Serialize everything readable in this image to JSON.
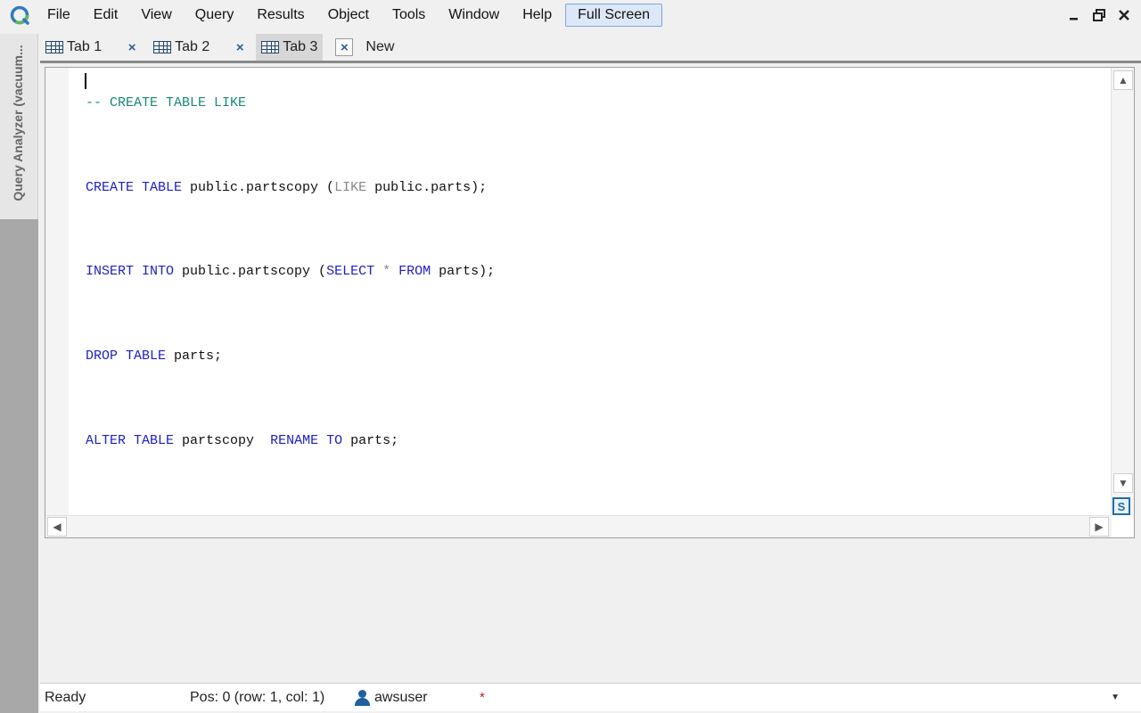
{
  "menu": {
    "items": [
      "File",
      "Edit",
      "View",
      "Query",
      "Results",
      "Object",
      "Tools",
      "Window",
      "Help"
    ],
    "fullscreen_label": "Full Screen"
  },
  "window_controls": {
    "minimize": "▁",
    "restore": "❐",
    "close": "✕"
  },
  "side_panel": {
    "label": "Query Analyzer (vacuum..."
  },
  "tabs": [
    {
      "label": "Tab 1",
      "close": "×",
      "active": false
    },
    {
      "label": "Tab 2",
      "close": "×",
      "active": false
    },
    {
      "label": "Tab 3",
      "close": "×",
      "active": true
    }
  ],
  "new_tab_label": "New",
  "editor": {
    "lines": [
      "-- CREATE TABLE LIKE",
      "",
      "CREATE TABLE public.partscopy (LIKE public.parts);",
      "",
      "INSERT INTO public.partscopy (SELECT * FROM parts);",
      "",
      "DROP TABLE parts;",
      "",
      "ALTER TABLE partscopy  RENAME TO parts;"
    ],
    "split_icon": "S"
  },
  "status": {
    "ready": "Ready",
    "position": "Pos: 0 (row: 1, col: 1)",
    "user": "awsuser",
    "modified": "*",
    "dropdown": "▼"
  },
  "colors": {
    "keyword": "#2020c8",
    "comment": "#178a7a",
    "accent": "#1f5f9f"
  }
}
